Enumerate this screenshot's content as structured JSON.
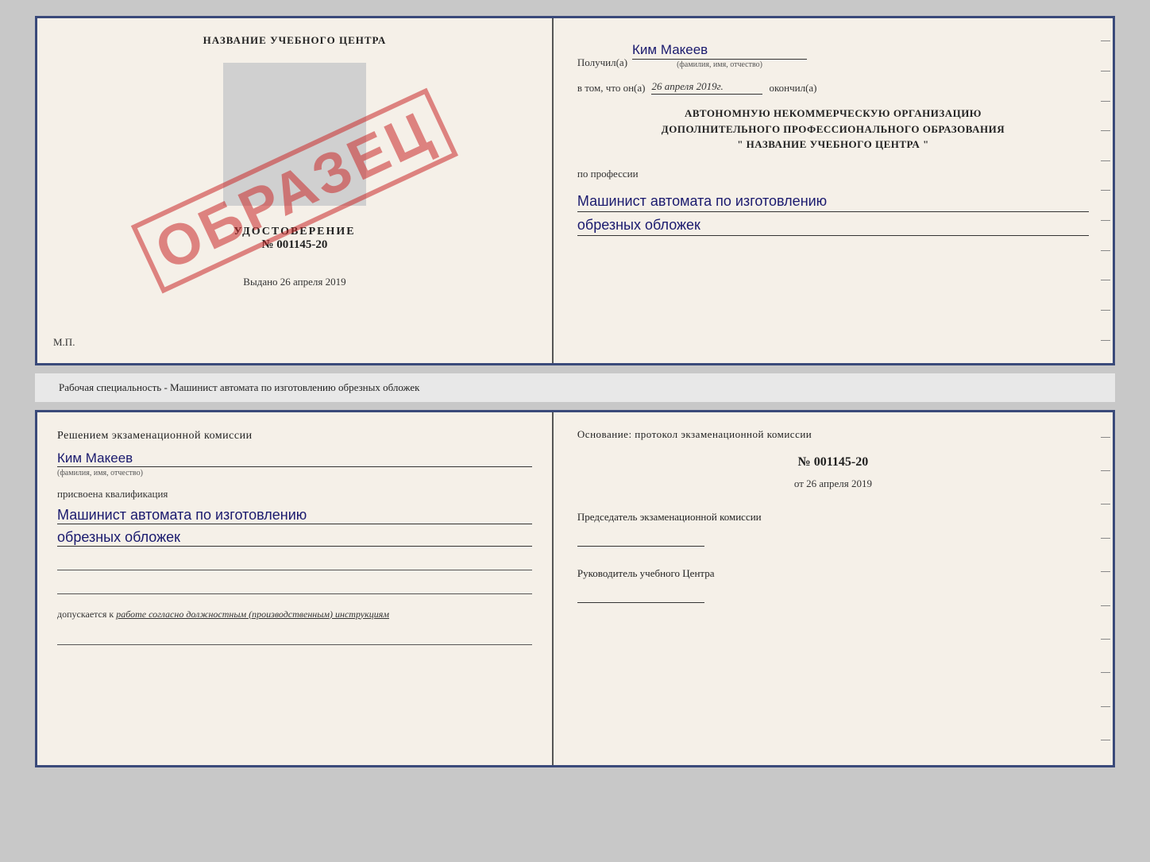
{
  "page": {
    "background": "#c8c8c8"
  },
  "top_doc": {
    "left": {
      "school_name": "НАЗВАНИЕ УЧЕБНОГО ЦЕНТРА",
      "udostoverenie_label": "УДОСТОВЕРЕНИЕ",
      "number": "№ 001145-20",
      "vydano_label": "Выдано",
      "vydano_date": "26 апреля 2019",
      "mp_label": "М.П.",
      "obrazec": "ОБРАЗЕЦ"
    },
    "right": {
      "poluchil_label": "Получил(а)",
      "recipient_name": "Ким Макеев",
      "fio_subtext": "(фамилия, имя, отчество)",
      "vtom_label": "в том, что он(а)",
      "date_value": "26 апреля 2019г.",
      "okonchil_label": "окончил(а)",
      "org_line1": "АВТОНОМНУЮ НЕКОММЕРЧЕСКУЮ ОРГАНИЗАЦИЮ",
      "org_line2": "ДОПОЛНИТЕЛЬНОГО ПРОФЕССИОНАЛЬНОГО ОБРАЗОВАНИЯ",
      "org_line3": "\"   НАЗВАНИЕ УЧЕБНОГО ЦЕНТРА   \"",
      "po_professii_label": "по профессии",
      "profession_line1": "Машинист автомата по изготовлению",
      "profession_line2": "обрезных обложек"
    }
  },
  "middle": {
    "text": "Рабочая специальность - Машинист автомата по изготовлению обрезных обложек"
  },
  "bottom_doc": {
    "left": {
      "commission_label": "Решением экзаменационной комиссии",
      "name_cursive": "Ким Макеев",
      "fio_subtext": "(фамилия, имя, отчество)",
      "prisvoena_label": "присвоена квалификация",
      "qualification_line1": "Машинист автомата по изготовлению",
      "qualification_line2": "обрезных обложек",
      "dopusk_label": "допускается к",
      "dopusk_text": "работе согласно должностным (производственным) инструкциям"
    },
    "right": {
      "osnovanie_label": "Основание: протокол экзаменационной комиссии",
      "protocol_number": "№ 001145-20",
      "ot_label": "от",
      "ot_date": "26 апреля 2019",
      "chairman_label": "Председатель экзаменационной комиссии",
      "rukovoditel_label": "Руководитель учебного Центра"
    }
  }
}
